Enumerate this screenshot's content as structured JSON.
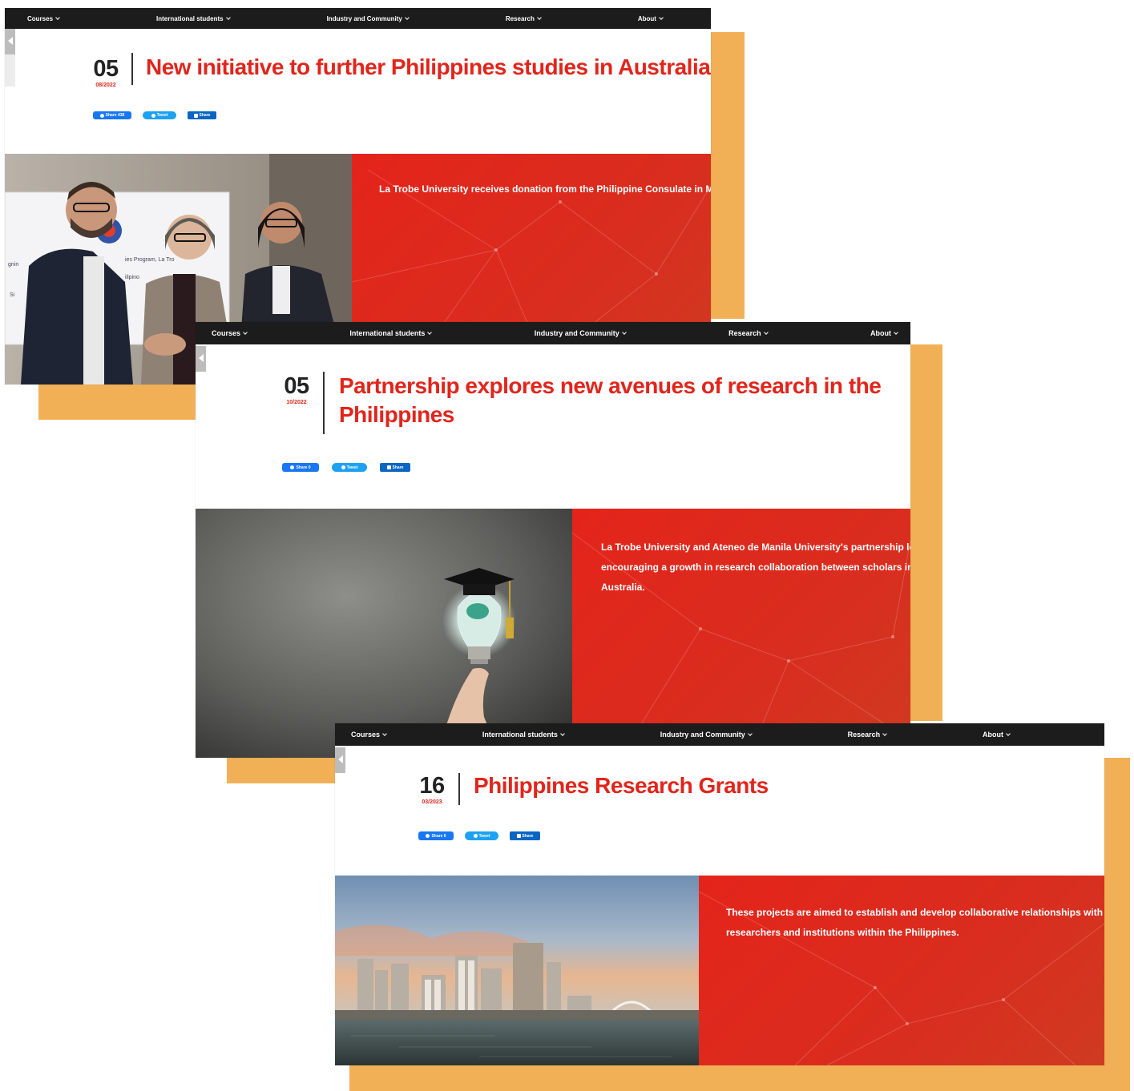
{
  "colors": {
    "accent_orange": "#f2b056",
    "brand_red": "#e1251b",
    "nav_bg": "#1c1c1c",
    "facebook_blue": "#1877f2",
    "twitter_blue": "#1da1f2",
    "linkedin_blue": "#0a66c2"
  },
  "nav": {
    "courses": "Courses",
    "international": "International students",
    "industry": "Industry and Community",
    "research": "Research",
    "about": "About"
  },
  "articles": [
    {
      "day": "05",
      "month_year": "08/2022",
      "title": "New initiative to further Philippines studies in Australia",
      "share_fb": "Share 438",
      "share_tw": "Tweet",
      "share_li": "Share",
      "lede": "La Trobe University receives donation from the Philippine Consulate in Melbo",
      "image": "photo-signing-handshake",
      "photo_caption_fragments": [
        "gnin",
        "ies Program, La Tro",
        "ilipino",
        "Si"
      ]
    },
    {
      "day": "05",
      "month_year": "10/2022",
      "title_line1": "Partnership explores new avenues of research in the",
      "title_line2": "Philippines",
      "share_fb": "Share 0",
      "share_tw": "Tweet",
      "share_li": "Share",
      "lede_line1": "La Trobe University and Ateneo de Manila University's partnership le",
      "lede_line2": "encouraging a growth in research collaboration between scholars in",
      "lede_line3": "Australia.",
      "image": "photo-graduation-cap-lightbulb"
    },
    {
      "day": "16",
      "month_year": "03/2023",
      "title": "Philippines Research Grants",
      "share_fb": "Share 6",
      "share_tw": "Tweet",
      "share_li": "Share",
      "lede_line1": "These projects are aimed to establish and develop collaborative relationships with",
      "lede_line2": "researchers and institutions within the Philippines.",
      "image": "photo-city-skyline-river"
    }
  ]
}
